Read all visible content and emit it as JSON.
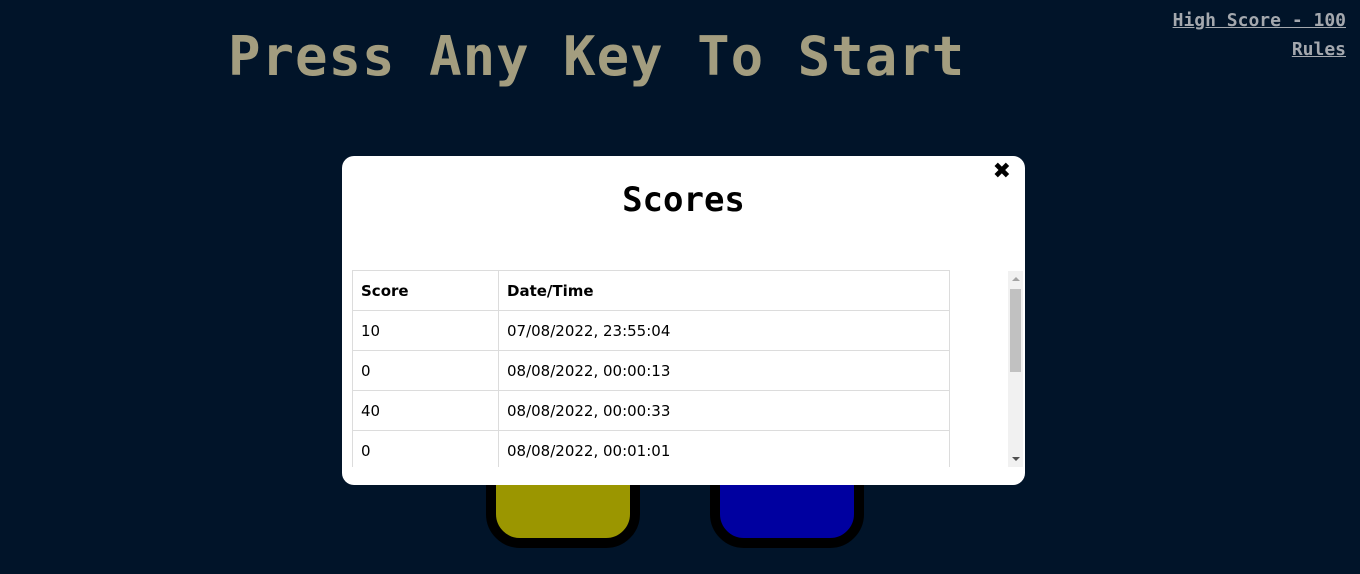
{
  "game": {
    "title": "Press Any Key To Start",
    "high_score_label": "High Score - 100",
    "rules_label": "Rules"
  },
  "pads": {
    "colors": {
      "green": "#00a000",
      "red": "#c00000",
      "yellow": "#9b9600",
      "blue": "#0000a0"
    }
  },
  "modal": {
    "title": "Scores",
    "close_icon": "close-icon",
    "table": {
      "headers": [
        "Score",
        "Date/Time"
      ],
      "rows": [
        [
          "10",
          "07/08/2022, 23:55:04"
        ],
        [
          "0",
          "08/08/2022, 00:00:13"
        ],
        [
          "40",
          "08/08/2022, 00:00:33"
        ],
        [
          "0",
          "08/08/2022, 00:01:01"
        ]
      ]
    }
  },
  "colors": {
    "background": "#011429",
    "title_text": "#a39d7f",
    "link_text": "#a4a8ae"
  }
}
